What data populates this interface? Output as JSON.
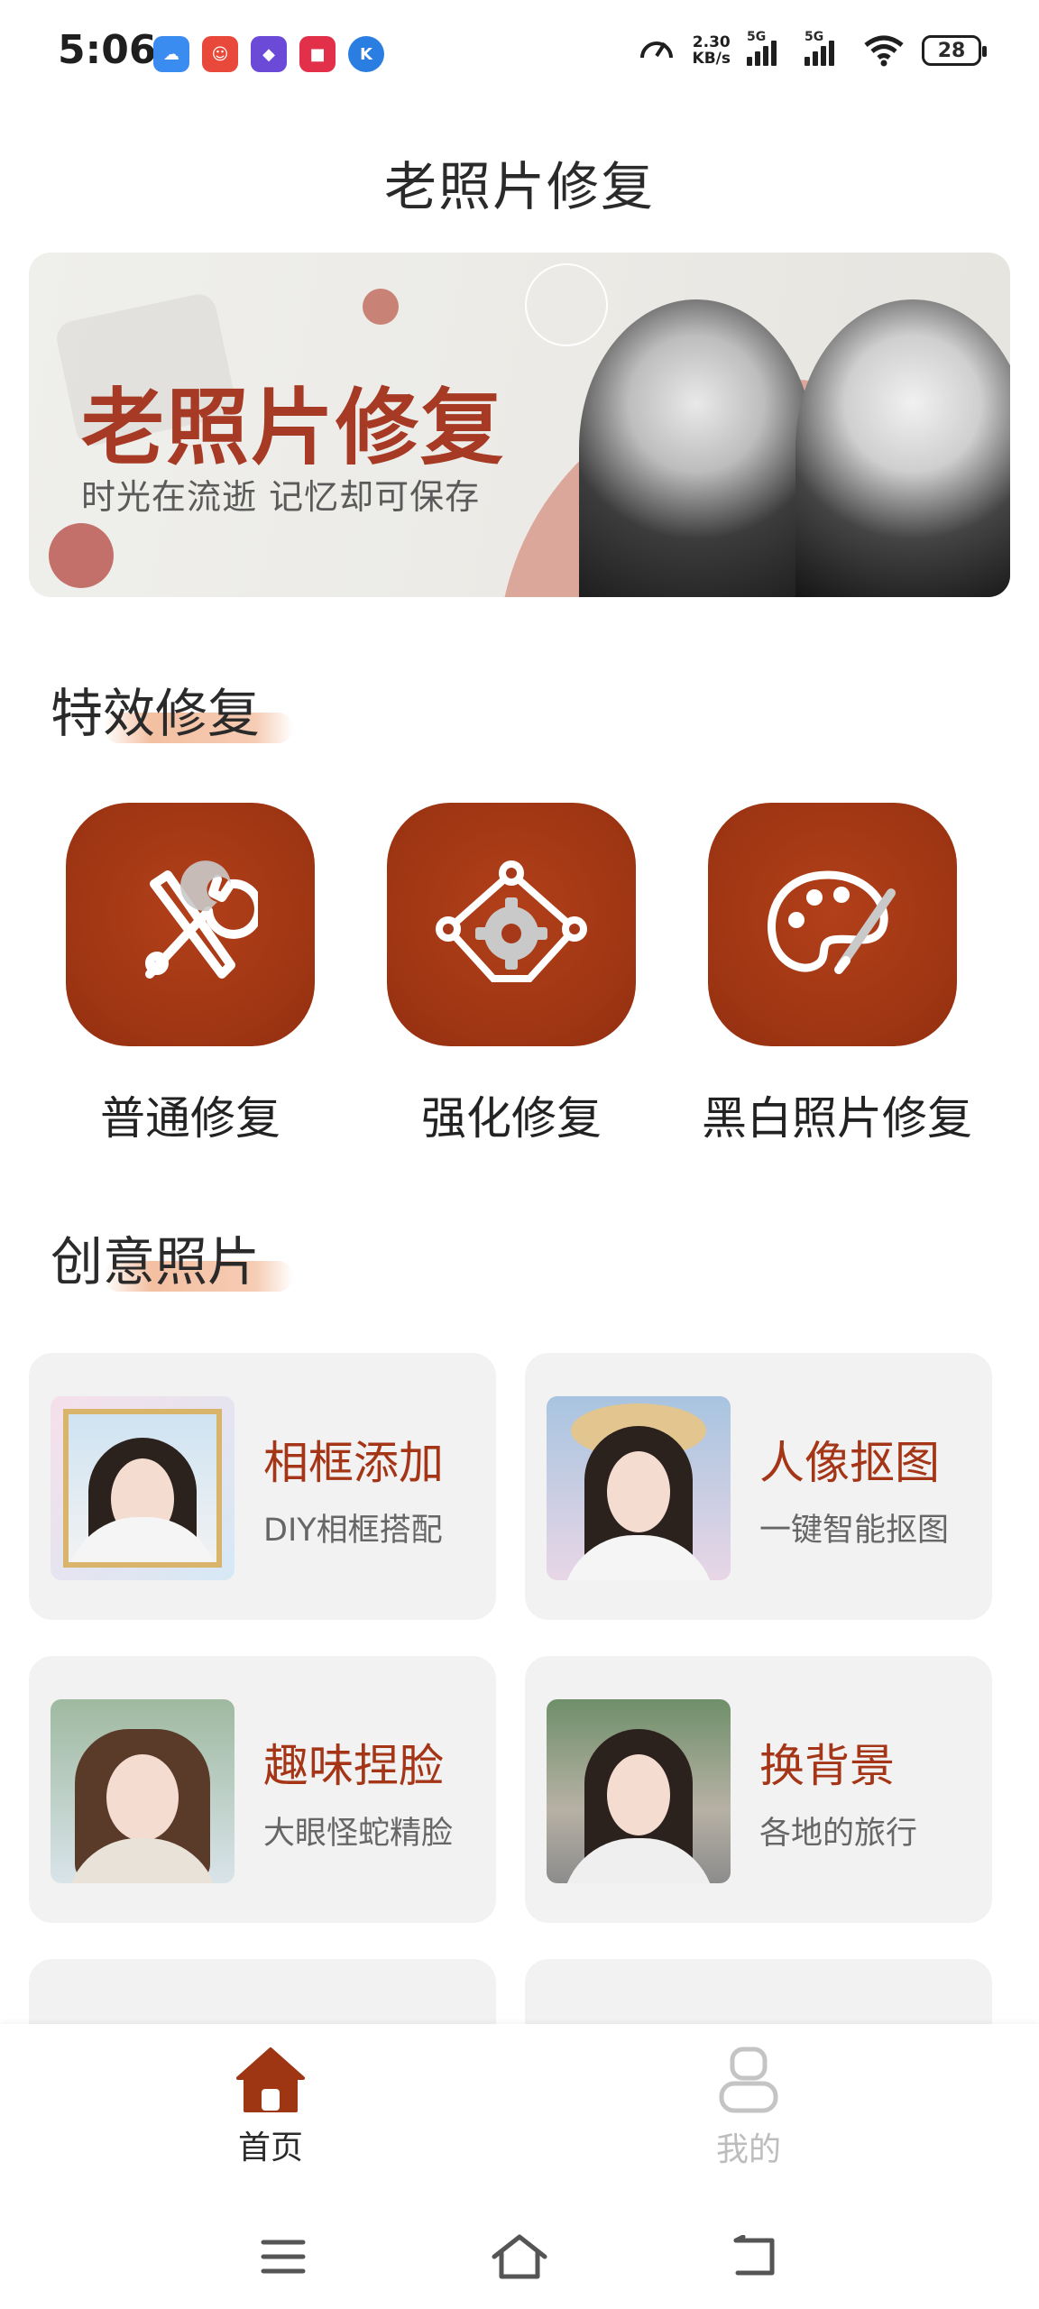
{
  "status_bar": {
    "time": "5:06",
    "net_speed_value": "2.30",
    "net_speed_unit": "KB/s",
    "signal1_label": "5G",
    "signal2_label": "5G",
    "battery": "28"
  },
  "header": {
    "title": "老照片修复"
  },
  "banner": {
    "title": "老照片修复",
    "subtitle": "时光在流逝  记忆却可保存"
  },
  "sections": {
    "effects": "特效修复",
    "creative": "创意照片"
  },
  "features": [
    {
      "label": "普通修复",
      "icon": "wrench-screwdriver-icon"
    },
    {
      "label": "强化修复",
      "icon": "gear-nodes-icon"
    },
    {
      "label": "黑白照片修复",
      "icon": "palette-icon"
    }
  ],
  "cards": [
    {
      "title": "相框添加",
      "subtitle": "DIY相框搭配"
    },
    {
      "title": "人像抠图",
      "subtitle": "一键智能抠图"
    },
    {
      "title": "趣味捏脸",
      "subtitle": "大眼怪蛇精脸"
    },
    {
      "title": "换背景",
      "subtitle": "各地的旅行"
    }
  ],
  "bottom_nav": {
    "home": "首页",
    "mine": "我的"
  },
  "colors": {
    "accent": "#9e3513",
    "card_bg": "#f2f2f2",
    "inactive": "#bdbdbd"
  }
}
